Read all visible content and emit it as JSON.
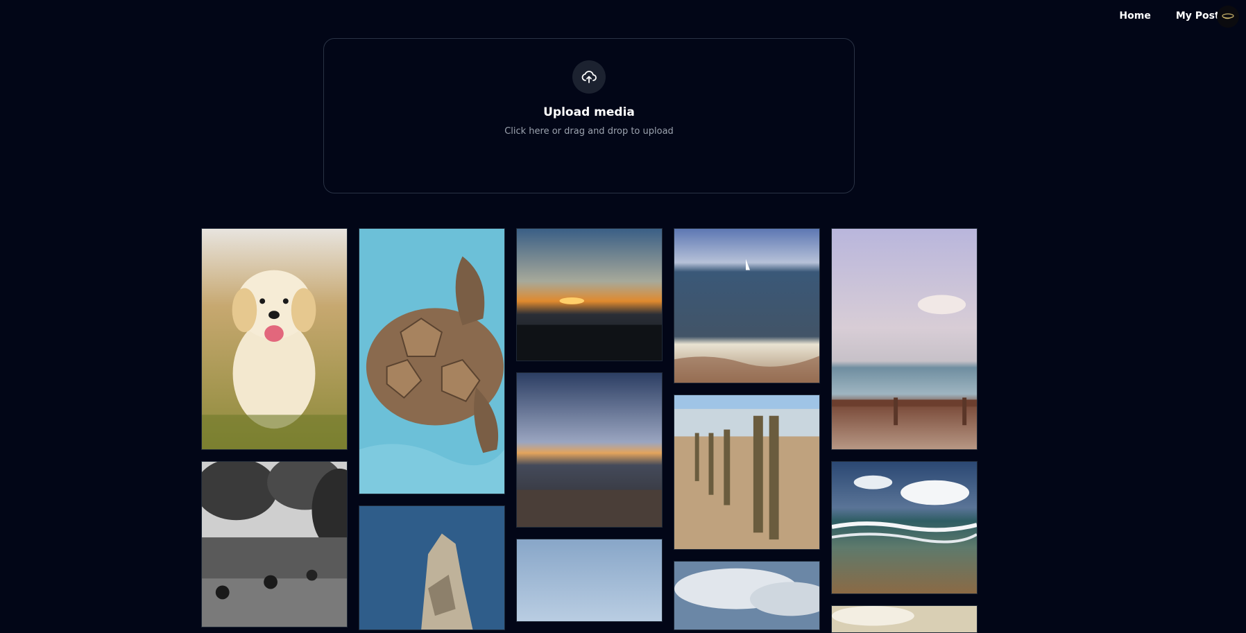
{
  "nav": {
    "home_label": "Home",
    "posts_label": "My Posts"
  },
  "upload": {
    "title": "Upload media",
    "subtitle": "Click here or drag and drop to upload"
  },
  "gallery": {
    "photos": [
      "puppy-running-in-grass",
      "sea-turtle-swimming",
      "sunset-over-bay",
      "beach-with-sailboat",
      "beach-with-boardwalk-railing",
      "street-with-motorcycles-bw",
      "rock-in-sea",
      "dusk-over-sea-and-dunes",
      "wooden-groynes-on-pebble-beach",
      "waves-on-shore",
      "blue-sky",
      "cloudy-sky",
      "clouds-partial"
    ]
  }
}
